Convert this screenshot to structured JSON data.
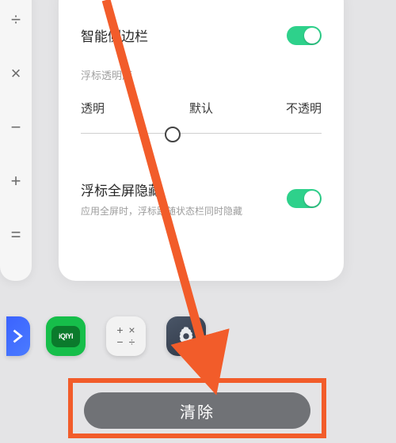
{
  "calculator_card": {
    "keys": [
      "÷",
      "×",
      "−",
      "+",
      "="
    ]
  },
  "settings_card": {
    "smart_sidebar": {
      "title": "智能侧边栏",
      "on": true
    },
    "opacity_section_label": "浮标透明度",
    "opacity_options": {
      "transparent": "透明",
      "default": "默认",
      "opaque": "不透明"
    },
    "slider_position_pct": 38,
    "fullscreen_hide": {
      "title": "浮标全屏隐藏",
      "subtitle": "应用全屏时，浮标跟随状态栏同时隐藏",
      "on": true
    }
  },
  "dock": {
    "iqiyi_label": "iQIYI"
  },
  "clear_button_label": "清除"
}
